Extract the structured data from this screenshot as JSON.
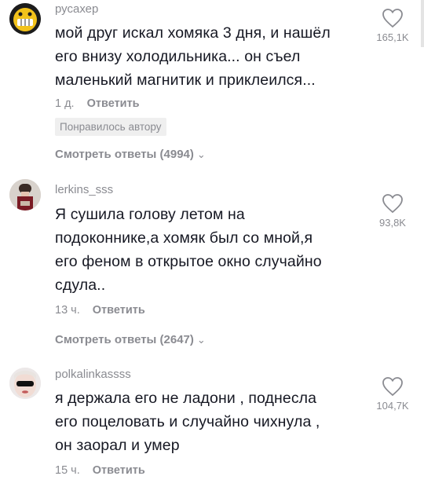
{
  "comments": [
    {
      "username": "русахер",
      "text": "мой друг искал хомяка 3 дня, и нашёл его внизу холодильника... он съел маленький магнитик и приклеился...",
      "lines": [
        "мой друг искал хомяка 3 дня, и нашёл",
        "его внизу холодильника... он съел",
        "маленький магнитик и приклеился..."
      ],
      "time": "1 д.",
      "reply_label": "Ответить",
      "liked_by_author": "Понравилось автору",
      "view_replies": "Смотреть ответы (4994)",
      "likes": "165,1K"
    },
    {
      "username": "lerkins_sss",
      "lines": [
        "Я сушила голову летом на",
        "подоконнике,а хомяк был со мной,я",
        "его феном в открытое окно случайно",
        "сдула.."
      ],
      "time": "13 ч.",
      "reply_label": "Ответить",
      "view_replies": "Смотреть ответы (2647)",
      "likes": "93,8K"
    },
    {
      "username": "polkalinkassss",
      "lines": [
        "я держала его не ладони , поднесла",
        "его поцеловать и случайно чихнула ,",
        "он заорал и умер"
      ],
      "time": "15 ч.",
      "reply_label": "Ответить",
      "likes": "104,7K"
    }
  ],
  "icons": {
    "like": "heart-outline-icon",
    "expand": "chevron-down-icon"
  },
  "colors": {
    "text": "#161823",
    "secondary": "#8a8b91",
    "badge_bg": "#efefef"
  }
}
